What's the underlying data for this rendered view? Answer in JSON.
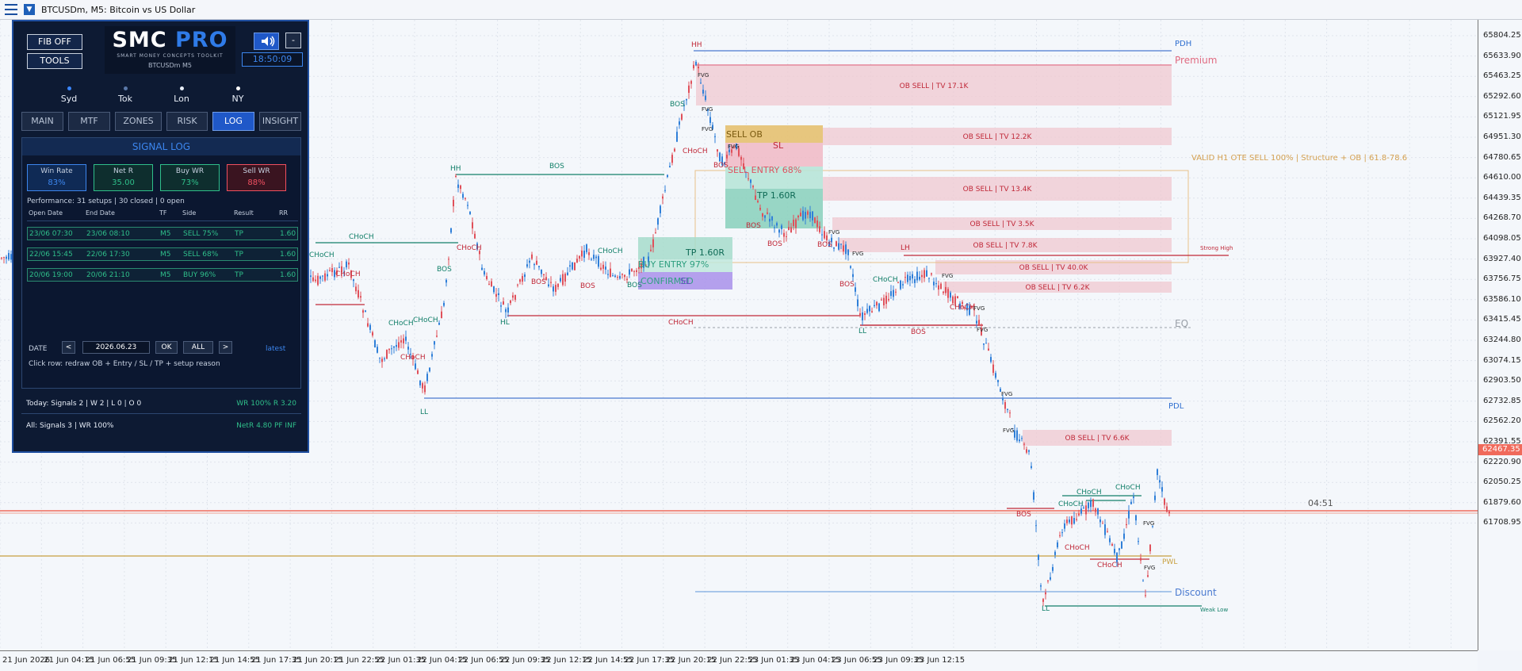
{
  "window": {
    "title": "BTCUSDm, M5:  Bitcoin vs US Dollar"
  },
  "price_axis": {
    "ticks": [
      "65804.25",
      "65633.90",
      "65463.25",
      "65292.60",
      "65121.95",
      "64951.30",
      "64780.65",
      "64610.00",
      "64439.35",
      "64268.70",
      "64098.05",
      "63927.40",
      "63756.75",
      "63586.10",
      "63415.45",
      "63244.80",
      "63074.15",
      "62903.50",
      "62732.85",
      "62562.20",
      "62391.55",
      "62220.90",
      "62050.25",
      "61879.60",
      "61708.95"
    ],
    "current": "62467.35"
  },
  "time_axis": {
    "ticks": [
      "21 Jun 2026",
      "21 Jun 04:15",
      "21 Jun 06:55",
      "21 Jun 09:35",
      "21 Jun 12:15",
      "21 Jun 14:55",
      "21 Jun 17:35",
      "21 Jun 20:15",
      "21 Jun 22:55",
      "22 Jun 01:35",
      "22 Jun 04:15",
      "22 Jun 06:55",
      "22 Jun 09:35",
      "22 Jun 12:15",
      "22 Jun 14:55",
      "22 Jun 17:35",
      "22 Jun 20:15",
      "22 Jun 22:55",
      "23 Jun 01:35",
      "23 Jun 04:15",
      "23 Jun 06:55",
      "23 Jun 09:35",
      "23 Jun 12:15"
    ]
  },
  "chart": {
    "labels": {
      "pdh": "PDH",
      "pdl": "PDL",
      "pwl": "PWL",
      "premium": "Premium",
      "discount": "Discount",
      "eq": "EQ",
      "strong_high": "Strong High",
      "weak_low": "Weak Low",
      "countdown": "04:51",
      "valid": "VALID H1 OTE SELL 100% | Structure + OB | 61.8-78.6",
      "sell_ob": "SELL OB",
      "sl": "SL",
      "sell_entry": "SELL ENTRY 68%",
      "tp_sell": "TP 1.60R",
      "tp_buy": "TP 1.60R",
      "buy_entry": "BUY ENTRY 97%",
      "confirmed": "CONFIRMED",
      "sl_buy": "SL",
      "hh": "HH",
      "ll": "LL",
      "hl": "HL",
      "lh": "LH",
      "bos": "BOS",
      "choch": "CHoCH",
      "fvg": "FVG"
    },
    "ob_zones": [
      "OB SELL | TV 17.1K",
      "OB SELL | TV 12.2K",
      "OB SELL | TV 13.4K",
      "OB SELL | TV 3.5K",
      "OB SELL | TV 7.8K",
      "OB SELL | TV 40.0K",
      "OB SELL | TV 6.2K",
      "OB SELL | TV 6.6K"
    ],
    "colors": {
      "bull": "#2f7fd8",
      "bear": "#e0505a",
      "structure_bull": "#13806a",
      "structure_bear": "#c02838",
      "ob": "#f0c8d0"
    }
  },
  "panel": {
    "fib_button": "FIB OFF",
    "tools_button": "TOOLS",
    "logo_main": "SMC",
    "logo_accent": "PRO",
    "logo_tagline": "SMART MONEY CONCEPTS TOOLKIT",
    "symbol": "BTCUSDm M5",
    "clock": "18:50:09",
    "minimize": "-",
    "sessions": [
      {
        "name": "Syd",
        "color": "#3a86ff"
      },
      {
        "name": "Tok",
        "color": "#5a78a8"
      },
      {
        "name": "Lon",
        "color": "#e8eef8"
      },
      {
        "name": "NY",
        "color": "#ffffff"
      }
    ],
    "tabs": [
      "MAIN",
      "MTF",
      "ZONES",
      "RISK",
      "LOG",
      "INSIGHT"
    ],
    "log_title": "SIGNAL LOG",
    "stats": [
      {
        "label": "Win Rate",
        "value": "83%"
      },
      {
        "label": "Net R",
        "value": "35.00"
      },
      {
        "label": "Buy WR",
        "value": "73%"
      },
      {
        "label": "Sell WR",
        "value": "88%"
      }
    ],
    "performance": "Performance: 31 setups | 30 closed | 0 open",
    "headers": [
      "Open Date",
      "End Date",
      "TF",
      "Side",
      "Result",
      "RR"
    ],
    "rows": [
      {
        "open": "23/06 07:30",
        "end": "23/06 08:10",
        "tf": "M5",
        "side": "SELL 75%",
        "result": "TP",
        "rr": "1.60"
      },
      {
        "open": "22/06 15:45",
        "end": "22/06 17:30",
        "tf": "M5",
        "side": "SELL 68%",
        "result": "TP",
        "rr": "1.60"
      },
      {
        "open": "20/06 19:00",
        "end": "20/06 21:10",
        "tf": "M5",
        "side": "BUY 96%",
        "result": "TP",
        "rr": "1.60"
      }
    ],
    "date_label": "DATE",
    "prev": "<",
    "date_value": "2026.06.23",
    "ok": "OK",
    "all": "ALL",
    "next": ">",
    "latest": "latest",
    "hint": "Click row: redraw OB + Entry / SL / TP + setup reason",
    "today": "Today: Signals 2 | W 2 | L 0 | O 0",
    "today_stats": "WR 100%  R 3.20",
    "all_summary": "All: Signals 3 | WR 100%",
    "all_stats": "NetR 4.80  PF INF"
  }
}
